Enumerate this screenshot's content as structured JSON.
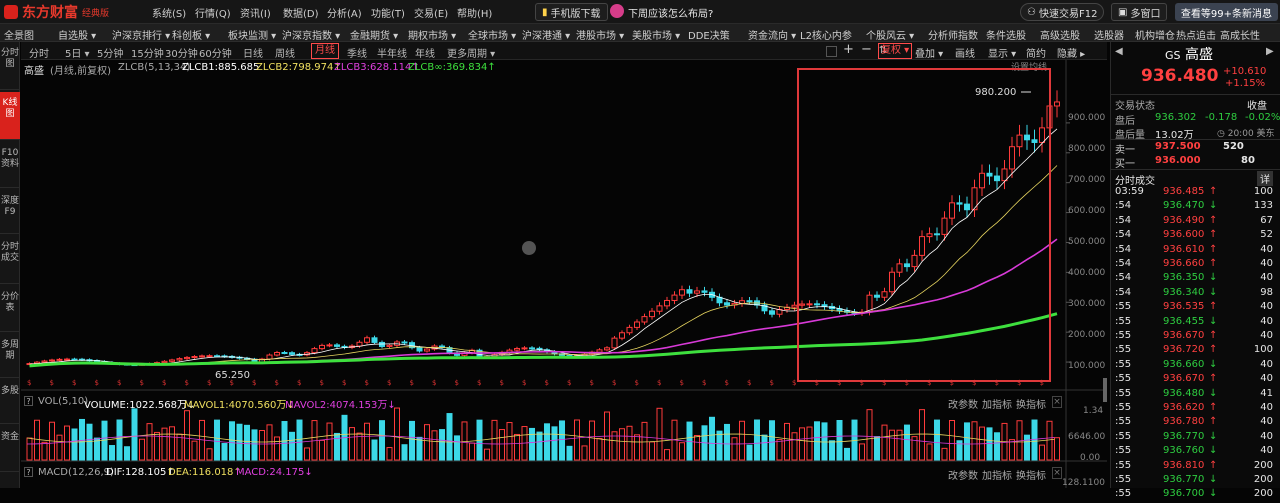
{
  "app": {
    "name": "东方财富",
    "edition": "经典版"
  },
  "topmenu": [
    "系统(S)",
    "行情(Q)",
    "资讯(I)",
    "数据(D)",
    "分析(A)",
    "功能(T)",
    "交易(E)",
    "帮助(H)"
  ],
  "topbar": {
    "mobile_download": "手机版下载",
    "question": "下周应该怎么布局?",
    "quick_trade": "快速交易F12",
    "multi_window": "多窗口",
    "news": "查看等99+条新消息"
  },
  "navbar": [
    "全景图",
    "自选股 ▾",
    "沪深京排行 ▾",
    "科创板 ▾",
    "板块监测 ▾",
    "沪深京指数 ▾",
    "金融期货 ▾",
    "期权市场 ▾",
    "全球市场 ▾",
    "沪深港通 ▾",
    "港股市场 ▾",
    "美股市场 ▾",
    "DDE决策",
    "资金流向 ▾",
    "L2核心内参",
    "个股风云 ▾",
    "分析师指数",
    "条件选股",
    "高级选股",
    "选股器",
    "机构增仓",
    "热点追击",
    "高成长性"
  ],
  "sidebar": [
    {
      "label": "分时图",
      "active": false
    },
    {
      "label": "K线图",
      "active": true
    },
    {
      "label": "F10资料",
      "active": false
    },
    {
      "label": "深度F9",
      "active": false
    },
    {
      "label": "分时成交",
      "active": false
    },
    {
      "label": "分价表",
      "active": false
    },
    {
      "label": "多周期",
      "active": false
    },
    {
      "label": "多股",
      "active": false
    },
    {
      "label": "资金",
      "active": false
    }
  ],
  "periods": [
    {
      "label": "分时",
      "active": false
    },
    {
      "label": "5日 ▾",
      "active": false
    },
    {
      "label": "5分钟",
      "active": false
    },
    {
      "label": "15分钟",
      "active": false
    },
    {
      "label": "30分钟",
      "active": false
    },
    {
      "label": "60分钟",
      "active": false
    },
    {
      "label": "日线",
      "active": false
    },
    {
      "label": "周线",
      "active": false
    },
    {
      "label": "月线",
      "active": true
    },
    {
      "label": "季线",
      "active": false
    },
    {
      "label": "半年线",
      "active": false
    },
    {
      "label": "年线",
      "active": false
    },
    {
      "label": "更多周期 ▾",
      "active": false
    }
  ],
  "tools": {
    "fuquan": "复权 ▾",
    "diejia": "叠加 ▾",
    "huaxian": "画线",
    "xianshi": "显示 ▾",
    "jianyue": "简约",
    "yincang": "隐藏 ▸",
    "shezhi": "设置均线"
  },
  "main_indicator": {
    "name": "高盛",
    "mode": "(月线,前复权)",
    "params": "ZLCB(5,13,34)",
    "zlcb1": "ZLCB1:885.685",
    "zlcb2": "ZLCB2:798.974↑",
    "zlcb3": "ZLCB3:628.114↑",
    "zlcbinf": "ZLCB∞:369.834↑"
  },
  "price_axis": [
    "900.000",
    "800.000",
    "700.000",
    "600.000",
    "500.000",
    "400.000",
    "300.000",
    "200.000",
    "100.000"
  ],
  "annotations": {
    "high": "980.200",
    "low": "65.250"
  },
  "vol_indicator": {
    "name": "VOL(5,10)",
    "volume": "VOLUME:1022.568万↓",
    "mavol1": "MAVOL1:4070.560万↓",
    "mavol2": "MAVOL2:4074.153万↓",
    "axis_top": "1.34",
    "axis_mid": "6646.00",
    "axis_bot": "0.00",
    "links": [
      "改参数",
      "加指标",
      "换指标"
    ]
  },
  "macd_indicator": {
    "name": "MACD(12,26,9)",
    "dif": "DIF:128.105↑",
    "dea": "DEA:116.018↑",
    "macd": "MACD:24.175↓",
    "axis_top": "128.1100",
    "links": [
      "改参数",
      "加指标",
      "换指标"
    ]
  },
  "quote": {
    "market": "GS",
    "name": "高盛",
    "price": "936.480",
    "change": "+10.610",
    "pct": "+1.15%",
    "status_label": "交易状态",
    "status": "收盘",
    "after_label": "盘后",
    "after_price": "936.302",
    "after_chg": "-0.178",
    "after_pct": "-0.02%",
    "after_vol_label": "盘后量",
    "after_vol": "13.02万",
    "time": "20:00 美东",
    "sell1_label": "卖一",
    "sell1": "937.500",
    "sell1_vol": "520",
    "buy1_label": "买一",
    "buy1": "936.000",
    "buy1_vol": "80",
    "ticks_label": "分时成交",
    "detail": "详"
  },
  "ticks": [
    {
      "t": "03:59",
      "p": "936.485",
      "v": "100",
      "d": "up"
    },
    {
      "t": ":54",
      "p": "936.470",
      "v": "133",
      "d": "dn"
    },
    {
      "t": ":54",
      "p": "936.490",
      "v": "67",
      "d": "up"
    },
    {
      "t": ":54",
      "p": "936.600",
      "v": "52",
      "d": "up"
    },
    {
      "t": ":54",
      "p": "936.610",
      "v": "40",
      "d": "up"
    },
    {
      "t": ":54",
      "p": "936.660",
      "v": "40",
      "d": "up"
    },
    {
      "t": ":54",
      "p": "936.350",
      "v": "40",
      "d": "dn"
    },
    {
      "t": ":54",
      "p": "936.340",
      "v": "98",
      "d": "dn"
    },
    {
      "t": ":55",
      "p": "936.535",
      "v": "40",
      "d": "up"
    },
    {
      "t": ":55",
      "p": "936.455",
      "v": "40",
      "d": "dn"
    },
    {
      "t": ":55",
      "p": "936.670",
      "v": "40",
      "d": "up"
    },
    {
      "t": ":55",
      "p": "936.720",
      "v": "100",
      "d": "up"
    },
    {
      "t": ":55",
      "p": "936.660",
      "v": "40",
      "d": "dn"
    },
    {
      "t": ":55",
      "p": "936.670",
      "v": "40",
      "d": "up"
    },
    {
      "t": ":55",
      "p": "936.480",
      "v": "41",
      "d": "dn"
    },
    {
      "t": ":55",
      "p": "936.620",
      "v": "40",
      "d": "up"
    },
    {
      "t": ":55",
      "p": "936.780",
      "v": "40",
      "d": "up"
    },
    {
      "t": ":55",
      "p": "936.770",
      "v": "40",
      "d": "dn"
    },
    {
      "t": ":55",
      "p": "936.760",
      "v": "40",
      "d": "dn"
    },
    {
      "t": ":55",
      "p": "936.810",
      "v": "200",
      "d": "up"
    },
    {
      "t": ":55",
      "p": "936.770",
      "v": "200",
      "d": "dn"
    },
    {
      "t": ":55",
      "p": "936.700",
      "v": "200",
      "d": "dn"
    }
  ],
  "chart_data": {
    "type": "candlestick",
    "x": "monthly bars",
    "ylim": [
      40,
      1010
    ],
    "high_label": 980.2,
    "low_label": 65.25
  }
}
